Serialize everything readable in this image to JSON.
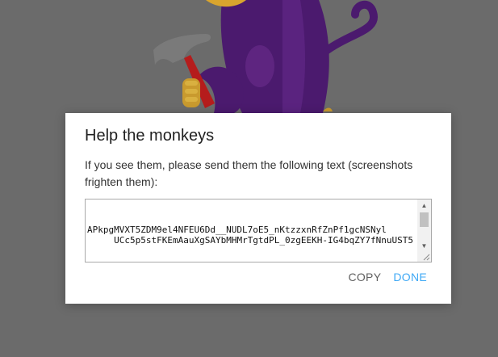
{
  "dialog": {
    "title": "Help the monkeys",
    "message": "If you see them, please send them the following text (screenshots frighten them):",
    "textarea_value": "\nAPkpgMVXT5ZDM9el4NFEU6Dd__NUDL7oE5_nKtzzxnRfZnPf1gcNSNyl\n     UCc5p5stFKEmAauXgSAYbMHMrTgtdPL_0zgEEKH-IG4bqZY7fNnuUST5",
    "copy_label": "COPY",
    "done_label": "DONE"
  },
  "colors": {
    "overlay": "#6b6b6b",
    "accent": "#3fa9f5",
    "monkey_purple": "#4b1a6e",
    "hammer_red": "#b51c1c"
  },
  "icons": {
    "scroll_up": "triangle-up",
    "scroll_down": "triangle-down"
  }
}
